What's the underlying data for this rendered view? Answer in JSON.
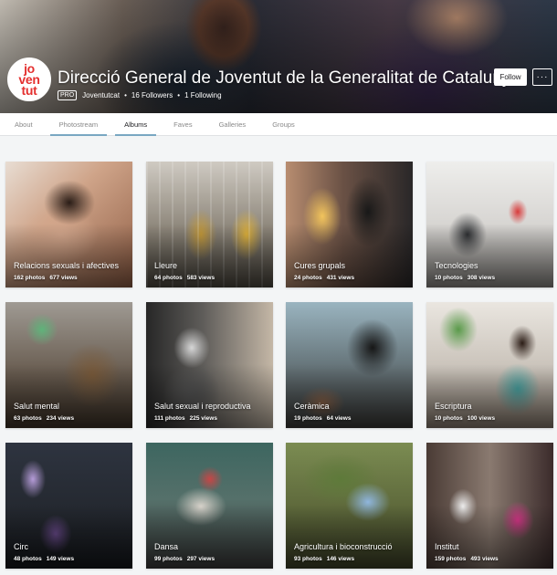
{
  "profile": {
    "logo_lines": [
      "jo",
      "ven",
      "tut"
    ],
    "title": "Direcció General de Joventut de la Generalitat de Catalunya",
    "pro_badge": "PRO",
    "username": "Joventutcat",
    "followers": "16 Followers",
    "separator": "•",
    "following": "1 Following",
    "follow_label": "Follow",
    "more_label": "···"
  },
  "tabs": [
    {
      "label": "About"
    },
    {
      "label": "Photostream"
    },
    {
      "label": "Albums"
    },
    {
      "label": "Faves"
    },
    {
      "label": "Galleries"
    },
    {
      "label": "Groups"
    }
  ],
  "albums": [
    {
      "title": "Relacions sexuals i afectives",
      "photos": "162 photos",
      "views": "677 views"
    },
    {
      "title": "Lleure",
      "photos": "64 photos",
      "views": "583 views"
    },
    {
      "title": "Cures grupals",
      "photos": "24 photos",
      "views": "431 views"
    },
    {
      "title": "Tecnologies",
      "photos": "10 photos",
      "views": "308 views"
    },
    {
      "title": "Salut mental",
      "photos": "63 photos",
      "views": "234 views"
    },
    {
      "title": "Salut sexual i reproductiva",
      "photos": "111 photos",
      "views": "225 views"
    },
    {
      "title": "Ceràmica",
      "photos": "19 photos",
      "views": "64 views"
    },
    {
      "title": "Escriptura",
      "photos": "10 photos",
      "views": "100 views"
    },
    {
      "title": "Circ",
      "photos": "48 photos",
      "views": "149 views"
    },
    {
      "title": "Dansa",
      "photos": "99 photos",
      "views": "297 views"
    },
    {
      "title": "Agricultura i bioconstrucció",
      "photos": "93 photos",
      "views": "146 views"
    },
    {
      "title": "Institut",
      "photos": "159 photos",
      "views": "493 views"
    }
  ],
  "colors": {
    "logo_red": "#e4302f",
    "tab_underline": "#79a7c2",
    "page_bg": "#f3f5f6"
  }
}
